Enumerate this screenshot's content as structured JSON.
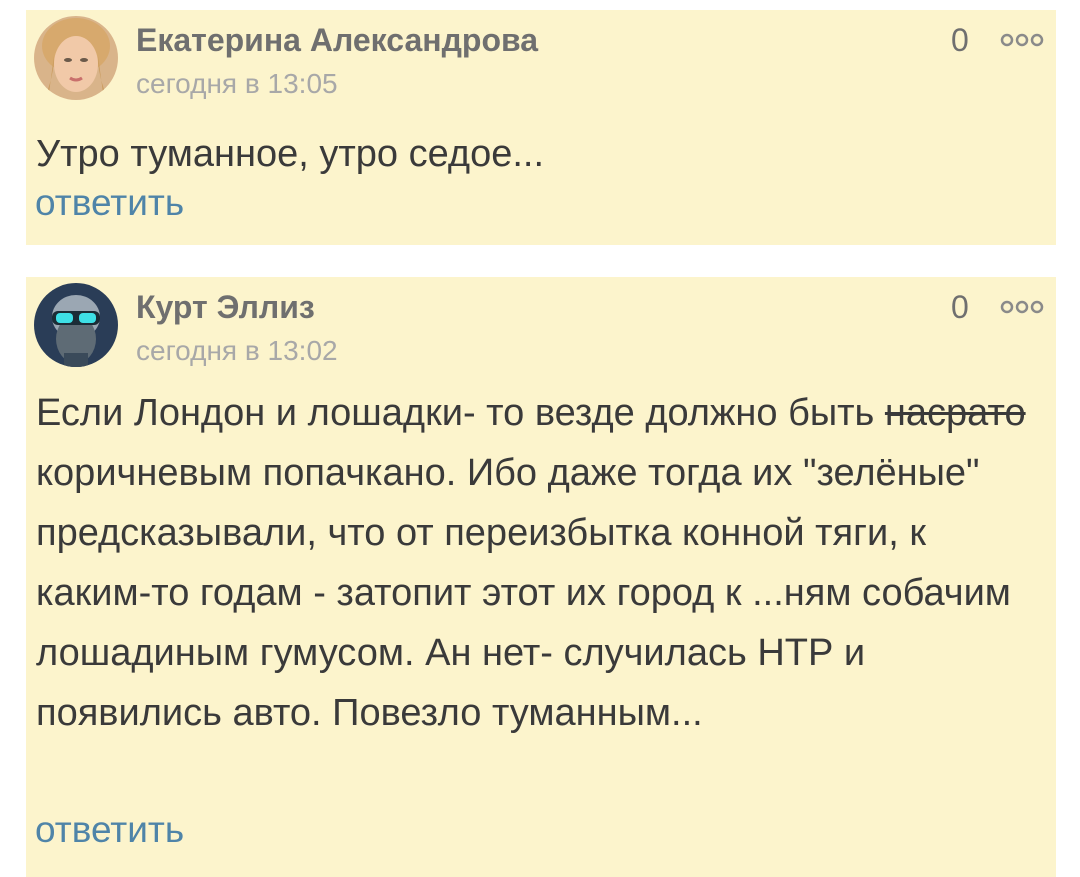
{
  "comments": [
    {
      "author": "Екатерина Александрова",
      "time": "сегодня в 13:05",
      "likes": "0",
      "text": "Утро туманное, утро седое...",
      "reply": "ответить"
    },
    {
      "author": "Курт Эллиз",
      "time": "сегодня в 13:02",
      "likes": "0",
      "text_start": "Если Лондон и лошадки- то везде должно быть ",
      "text_strike": "насрато",
      "text_rest": " коричневым попачкано. Ибо даже тогда их \"зелёные\" предсказывали, что от переизбытка конной тяги, к каким-то годам - затопит этот их город к ...ням собачим лошадиным гумусом. Ан нет- случилась НТР и появились авто. Повезло туманным...",
      "reply": "ответить"
    }
  ],
  "icons": {
    "more": "more-dots-icon",
    "avatar1": "avatar-woman",
    "avatar2": "avatar-man-goggles"
  },
  "colors": {
    "card_bg": "#fcf4cc",
    "author": "#6f6f6f",
    "time": "#a8a8a8",
    "text": "#3a3a3a",
    "link": "#4f84a8"
  }
}
